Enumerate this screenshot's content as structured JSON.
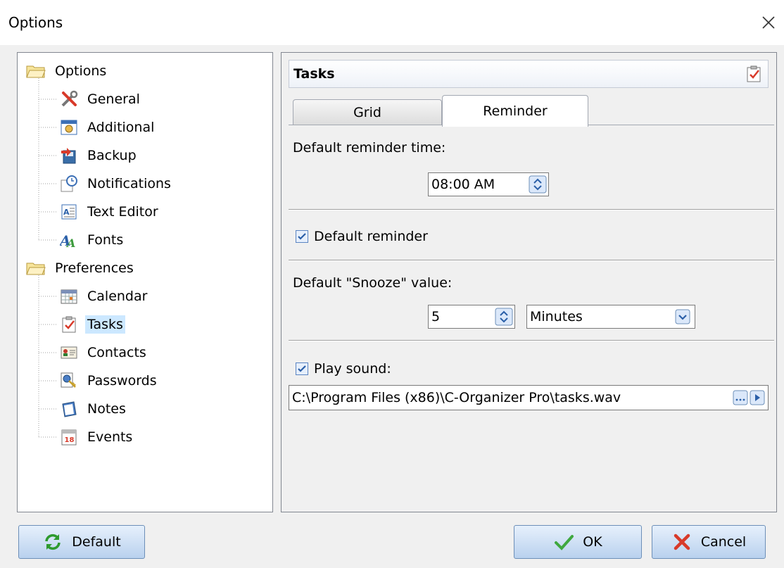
{
  "window": {
    "title": "Options"
  },
  "tree": {
    "groups": [
      {
        "label": "Options",
        "items": [
          "General",
          "Additional",
          "Backup",
          "Notifications",
          "Text Editor",
          "Fonts"
        ]
      },
      {
        "label": "Preferences",
        "items": [
          "Calendar",
          "Tasks",
          "Contacts",
          "Passwords",
          "Notes",
          "Events"
        ]
      }
    ],
    "selected": "Tasks",
    "events_icon_number": "18"
  },
  "panel": {
    "title": "Tasks",
    "tabs": [
      {
        "label": "Grid",
        "active": false
      },
      {
        "label": "Reminder",
        "active": true
      }
    ],
    "reminder": {
      "default_time_label": "Default reminder time:",
      "default_time_value": "08:00 AM",
      "default_reminder_label": "Default reminder",
      "default_reminder_checked": true,
      "snooze_label": "Default \"Snooze\" value:",
      "snooze_value": "5",
      "snooze_unit": "Minutes",
      "play_sound_label": "Play sound:",
      "play_sound_checked": true,
      "sound_path": "C:\\Program Files (x86)\\C-Organizer Pro\\tasks.wav"
    }
  },
  "buttons": {
    "default": "Default",
    "ok": "OK",
    "cancel": "Cancel"
  },
  "colors": {
    "selection": "#cce8ff",
    "button_top": "#e6f0fc",
    "button_bottom": "#b9d1ee",
    "accent": "#3d7fd6"
  }
}
